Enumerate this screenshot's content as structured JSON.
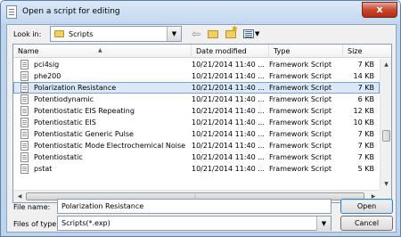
{
  "window": {
    "title": "Open a script for editing",
    "close_glyph": "x"
  },
  "lookin": {
    "label": "Look in:",
    "value": "Scripts"
  },
  "columns": {
    "name": "Name",
    "date": "Date modified",
    "type": "Type",
    "size": "Size"
  },
  "files": [
    {
      "name": "pci4sig",
      "date": "10/21/2014 11:40 ...",
      "type": "Framework Script",
      "size": "7 KB",
      "selected": false
    },
    {
      "name": "phe200",
      "date": "10/21/2014 11:40 ...",
      "type": "Framework Script",
      "size": "14 KB",
      "selected": false
    },
    {
      "name": "Polarization Resistance",
      "date": "10/21/2014 11:40 ...",
      "type": "Framework Script",
      "size": "7 KB",
      "selected": true
    },
    {
      "name": "Potentiodynamic",
      "date": "10/21/2014 11:40 ...",
      "type": "Framework Script",
      "size": "6 KB",
      "selected": false
    },
    {
      "name": "Potentiostatic EIS Repeating",
      "date": "10/21/2014 11:40 ...",
      "type": "Framework Script",
      "size": "12 KB",
      "selected": false
    },
    {
      "name": "Potentiostatic EIS",
      "date": "10/21/2014 11:40 ...",
      "type": "Framework Script",
      "size": "10 KB",
      "selected": false
    },
    {
      "name": "Potentiostatic Generic Pulse",
      "date": "10/21/2014 11:40 ...",
      "type": "Framework Script",
      "size": "7 KB",
      "selected": false
    },
    {
      "name": "Potentiostatic Mode Electrochemical Noise",
      "date": "10/21/2014 11:40 ...",
      "type": "Framework Script",
      "size": "7 KB",
      "selected": false
    },
    {
      "name": "Potentiostatic",
      "date": "10/21/2014 11:40 ...",
      "type": "Framework Script",
      "size": "7 KB",
      "selected": false
    },
    {
      "name": "pstat",
      "date": "10/21/2014 11:40 ...",
      "type": "Framework Script",
      "size": "5 KB",
      "selected": false
    }
  ],
  "filename": {
    "label": "File name:",
    "value": "Polarization Resistance"
  },
  "filetype": {
    "label": "Files of type:",
    "value": "Scripts(*.exp)"
  },
  "buttons": {
    "open": "Open",
    "cancel": "Cancel"
  },
  "colors": {
    "selection_bg": "#dbe8f8",
    "selection_border": "#7da2ce",
    "close_red": "#c9462c"
  }
}
